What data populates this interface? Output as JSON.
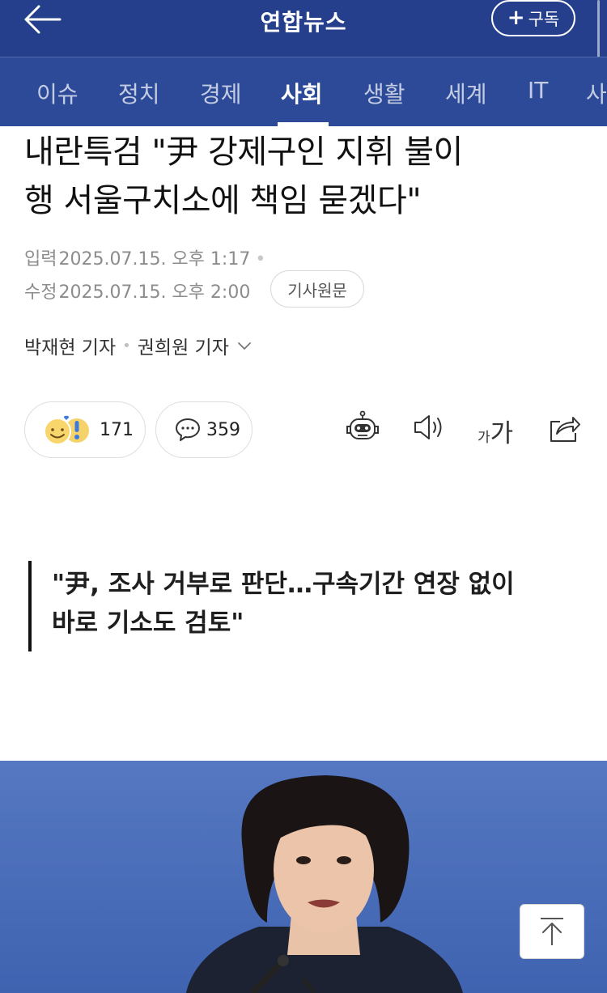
{
  "header": {
    "brand": "연합뉴스",
    "subscribe_label": "구독"
  },
  "nav": {
    "tabs": [
      {
        "label": "이슈",
        "active": false
      },
      {
        "label": "정치",
        "active": false
      },
      {
        "label": "경제",
        "active": false
      },
      {
        "label": "사회",
        "active": true
      },
      {
        "label": "생활",
        "active": false
      },
      {
        "label": "세계",
        "active": false
      },
      {
        "label": "IT",
        "active": false
      },
      {
        "label": "사",
        "active": false
      }
    ]
  },
  "article": {
    "headline_line1": "내란특검 \"尹 강제구인 지휘 불이",
    "headline_line2": "행 서울구치소에 책임 묻겠다\"",
    "input_label": "입력",
    "input_time": "2025.07.15. 오후 1:17",
    "edit_label": "수정",
    "edit_time": "2025.07.15. 오후 2:00",
    "original_button": "기사원문",
    "author1": "박재현 기자",
    "author2": "권희원 기자",
    "reaction_count": "171",
    "comment_count": "359",
    "font_small": "가",
    "font_big": "가",
    "subhead_line1": "\"尹, 조사 거부로 판단…구속기간 연장 없이",
    "subhead_line2": "바로 기소도 검토\""
  },
  "colors": {
    "header_bg": "#263f8c",
    "nav_bg": "#2c4a98",
    "photo_bg": "#4a6db8"
  },
  "icons": [
    "back-arrow-icon",
    "plus-icon",
    "emoji-reaction-icon",
    "comment-bubble-icon",
    "ai-robot-icon",
    "speaker-icon",
    "share-icon",
    "chevron-down-icon",
    "arrow-up-icon"
  ]
}
